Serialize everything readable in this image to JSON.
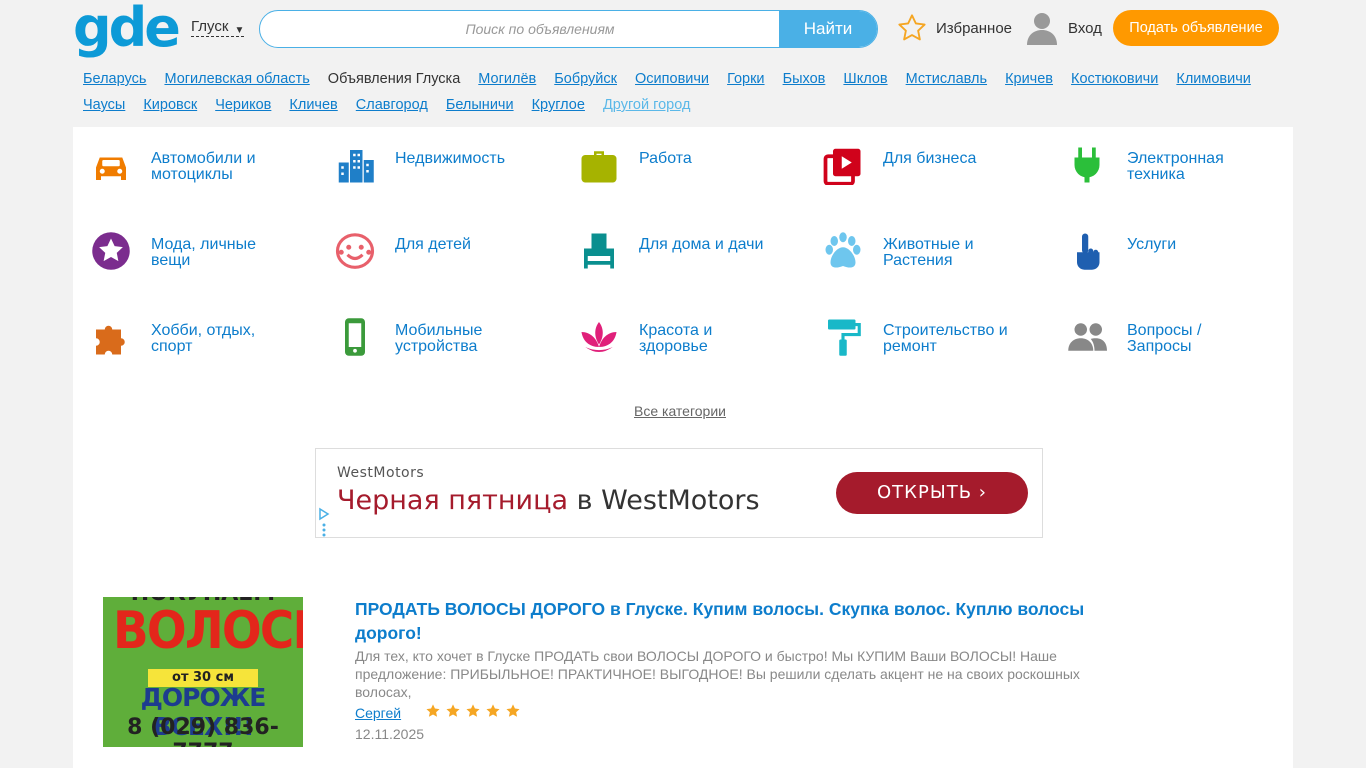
{
  "header": {
    "logo": "gde",
    "city": "Глуск",
    "search_placeholder": "Поиск по объявлениям",
    "search_button": "Найти",
    "favorites_label": "Избранное",
    "login_label": "Вход",
    "post_button": "Подать объявление"
  },
  "regions": {
    "items": [
      {
        "label": "Беларусь",
        "type": "link"
      },
      {
        "label": "Могилевская область",
        "type": "link"
      },
      {
        "label": "Объявления Глуска",
        "type": "current"
      },
      {
        "label": "Могилёв",
        "type": "link"
      },
      {
        "label": "Бобруйск",
        "type": "link"
      },
      {
        "label": "Осиповичи",
        "type": "link"
      },
      {
        "label": "Горки",
        "type": "link"
      },
      {
        "label": "Быхов",
        "type": "link"
      },
      {
        "label": "Шклов",
        "type": "link"
      },
      {
        "label": "Мстиславль",
        "type": "link"
      },
      {
        "label": "Кричев",
        "type": "link"
      },
      {
        "label": "Костюковичи",
        "type": "link"
      },
      {
        "label": "Климовичи",
        "type": "link"
      },
      {
        "label": "Чаусы",
        "type": "link"
      },
      {
        "label": "Кировск",
        "type": "link"
      },
      {
        "label": "Чериков",
        "type": "link"
      },
      {
        "label": "Кличев",
        "type": "link"
      },
      {
        "label": "Славгород",
        "type": "link"
      },
      {
        "label": "Белыничи",
        "type": "link"
      },
      {
        "label": "Круглое",
        "type": "link"
      },
      {
        "label": "Другой город",
        "type": "other"
      }
    ]
  },
  "categories": [
    {
      "label": "Автомобили и мотоциклы",
      "icon": "car-icon",
      "color": "#f07c00"
    },
    {
      "label": "Недвижимость",
      "icon": "buildings-icon",
      "color": "#1f7fc8"
    },
    {
      "label": "Работа",
      "icon": "briefcase-icon",
      "color": "#a6b300"
    },
    {
      "label": "Для бизнеса",
      "icon": "business-play-icon",
      "color": "#d0021b"
    },
    {
      "label": "Электронная техника",
      "icon": "plug-icon",
      "color": "#2bbf3a"
    },
    {
      "label": "Мода, личные вещи",
      "icon": "star-badge-icon",
      "color": "#7b2c8e"
    },
    {
      "label": "Для детей",
      "icon": "smiley-icon",
      "color": "#e8606b"
    },
    {
      "label": "Для дома и дачи",
      "icon": "armchair-icon",
      "color": "#0a8f8f"
    },
    {
      "label": "Животные и Растения",
      "icon": "paw-icon",
      "color": "#6ec6ee"
    },
    {
      "label": "Услуги",
      "icon": "hand-pointer-icon",
      "color": "#1f5fb0"
    },
    {
      "label": "Хобби, отдых, спорт",
      "icon": "puzzle-icon",
      "color": "#d96b1b"
    },
    {
      "label": "Мобильные устройства",
      "icon": "mobile-icon",
      "color": "#3b9a3b"
    },
    {
      "label": "Красота и здоровье",
      "icon": "lotus-icon",
      "color": "#e0207a"
    },
    {
      "label": "Строительство и ремонт",
      "icon": "paint-roller-icon",
      "color": "#19b8c8"
    },
    {
      "label": "Вопросы / Запросы",
      "icon": "users-icon",
      "color": "#888888"
    }
  ],
  "all_categories": "Все категории",
  "ad": {
    "brand": "WestMotors",
    "headline_red": "Черная пятница",
    "headline_rest": " в WestMotors",
    "button": "ОТКРЫТЬ"
  },
  "listing": {
    "image_lines": [
      "ПОКУПАЕМ",
      "ВОЛОСЫ",
      "от 30 см",
      "ДОРОЖЕ ВСЕХ!!!",
      "8 (029) 836-7777"
    ],
    "title": "ПРОДАТЬ ВОЛОСЫ ДОРОГО в Глуске. Купим волосы. Скупка волос. Куплю волосы дорого!",
    "description": "Для тех, кто хочет в Глуске ПРОДАТЬ свои ВОЛОСЫ ДОРОГО и быстро! Мы КУПИМ Ваши ВОЛОСЫ! Наше предложение: ПРИБЫЛЬНОЕ! ПРАКТИЧНОЕ! ВЫГОДНОЕ! Вы решили сделать акцент не на своих роскошных волосах,",
    "author": "Сергей",
    "rating": 5,
    "date": "12.11.2025"
  },
  "colors": {
    "brand": "#0d9ad7",
    "link": "#0d7dcc",
    "accent": "#ff9900",
    "ad_red": "#a51b2c"
  }
}
